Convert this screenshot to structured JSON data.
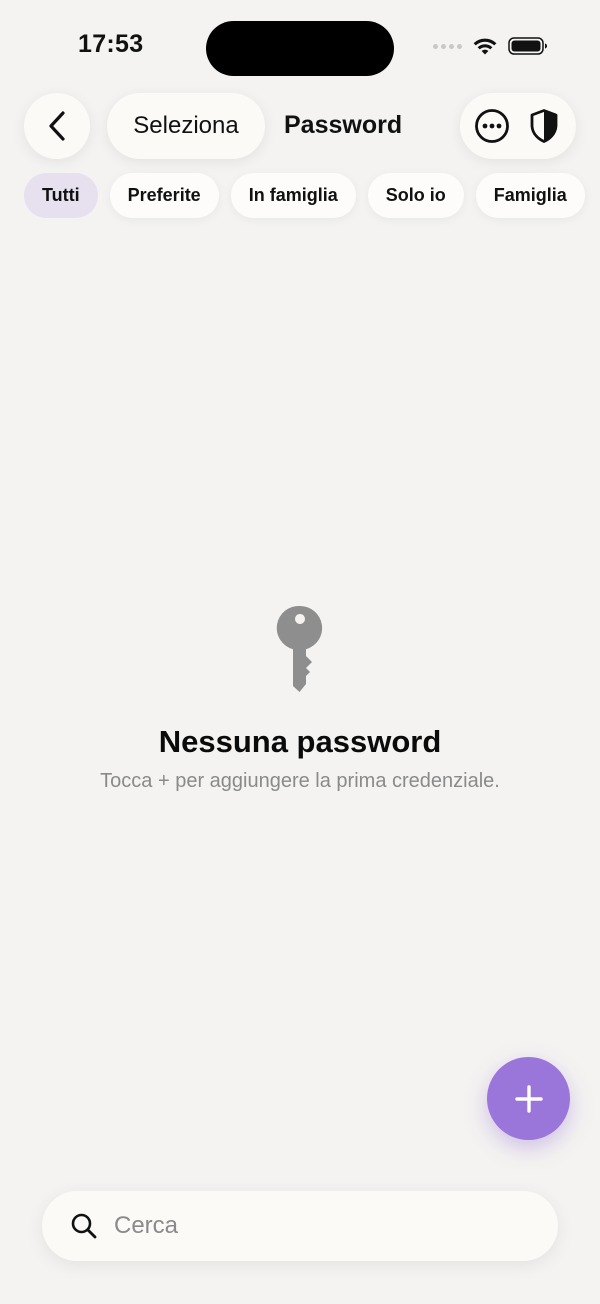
{
  "status_bar": {
    "time": "17:53"
  },
  "header": {
    "back_icon": "chevron-left-icon",
    "select_label": "Seleziona",
    "title": "Password",
    "more_icon": "ellipsis-circle-icon",
    "shield_icon": "shield-half-icon"
  },
  "filters": [
    {
      "label": "Tutti",
      "active": true
    },
    {
      "label": "Preferite",
      "active": false
    },
    {
      "label": "In famiglia",
      "active": false
    },
    {
      "label": "Solo io",
      "active": false
    },
    {
      "label": "Famiglia",
      "active": false
    }
  ],
  "empty_state": {
    "icon": "key-icon",
    "title": "Nessuna password",
    "subtitle": "Tocca + per aggiungere la prima credenziale."
  },
  "fab": {
    "icon": "plus-icon"
  },
  "search": {
    "icon": "search-icon",
    "placeholder": "Cerca"
  },
  "colors": {
    "background": "#f4f3f1",
    "accent": "#9a75da",
    "active_chip": "#e6e0ef",
    "muted_text": "#8a8a8a",
    "icon_gray": "#8e8e8e"
  }
}
